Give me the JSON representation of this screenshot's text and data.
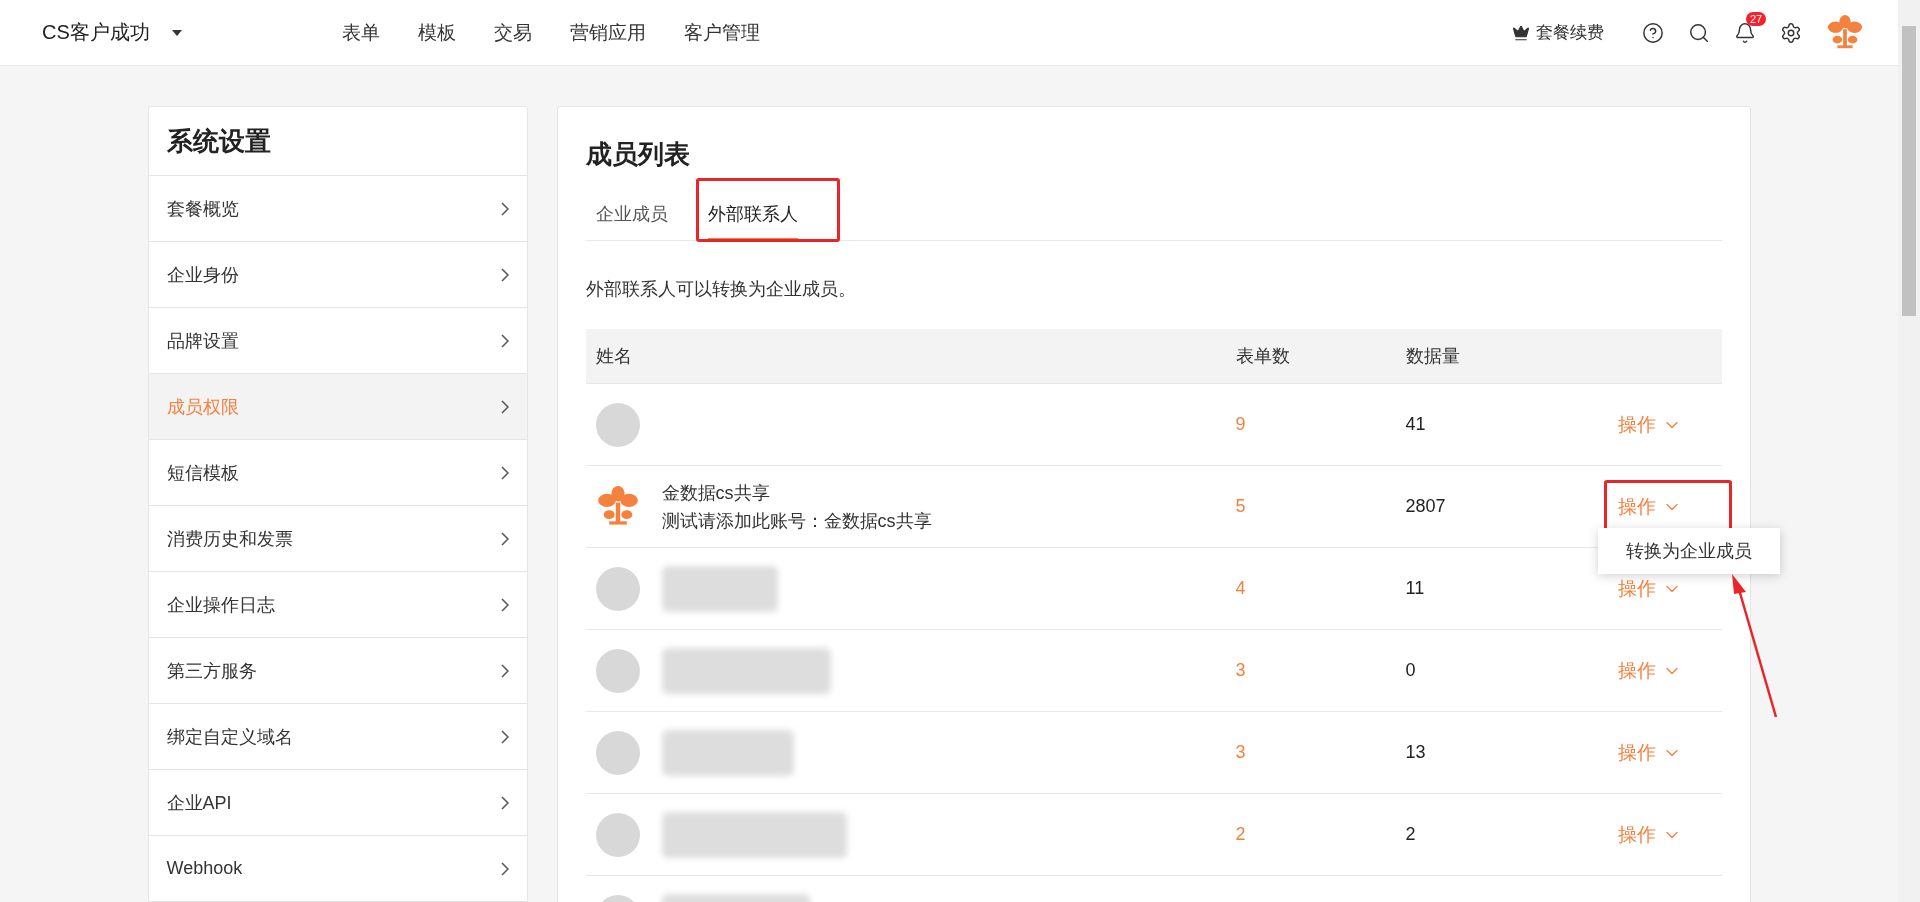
{
  "topbar": {
    "brand": "CS客户成功",
    "nav": [
      "表单",
      "模板",
      "交易",
      "营销应用",
      "客户管理"
    ],
    "renew": "套餐续费",
    "notification_count": "27"
  },
  "sidebar": {
    "title": "系统设置",
    "items": [
      {
        "label": "套餐概览",
        "selected": false
      },
      {
        "label": "企业身份",
        "selected": false
      },
      {
        "label": "品牌设置",
        "selected": false
      },
      {
        "label": "成员权限",
        "selected": true
      },
      {
        "label": "短信模板",
        "selected": false
      },
      {
        "label": "消费历史和发票",
        "selected": false
      },
      {
        "label": "企业操作日志",
        "selected": false
      },
      {
        "label": "第三方服务",
        "selected": false
      },
      {
        "label": "绑定自定义域名",
        "selected": false
      },
      {
        "label": "企业API",
        "selected": false
      },
      {
        "label": "Webhook",
        "selected": false
      }
    ]
  },
  "main": {
    "title": "成员列表",
    "tabs": [
      {
        "label": "企业成员",
        "selected": false,
        "highlighted": false
      },
      {
        "label": "外部联系人",
        "selected": true,
        "highlighted": true
      }
    ],
    "description": "外部联系人可以转换为企业成员。",
    "table": {
      "columns": [
        "姓名",
        "表单数",
        "数据量"
      ],
      "rows": [
        {
          "kind": "photo",
          "redacted": false,
          "forms": "9",
          "data": "41",
          "action": "操作",
          "menu_open": false
        },
        {
          "kind": "logo",
          "name": "金数据cs共享",
          "subtitle": "测试请添加此账号：金数据cs共享",
          "redacted": false,
          "forms": "5",
          "data": "2807",
          "action": "操作",
          "menu_open": true
        },
        {
          "kind": "photo",
          "redacted": true,
          "forms": "4",
          "data": "11",
          "action": "操作",
          "menu_open": false
        },
        {
          "kind": "photo",
          "redacted": true,
          "forms": "3",
          "data": "0",
          "action": "操作",
          "menu_open": false
        },
        {
          "kind": "photo",
          "redacted": true,
          "forms": "3",
          "data": "13",
          "action": "操作",
          "menu_open": false
        },
        {
          "kind": "photo",
          "redacted": true,
          "forms": "2",
          "data": "2",
          "action": "操作",
          "menu_open": false
        },
        {
          "kind": "photo",
          "redacted": true
        }
      ]
    },
    "action_menu": [
      "转换为企业成员"
    ]
  }
}
